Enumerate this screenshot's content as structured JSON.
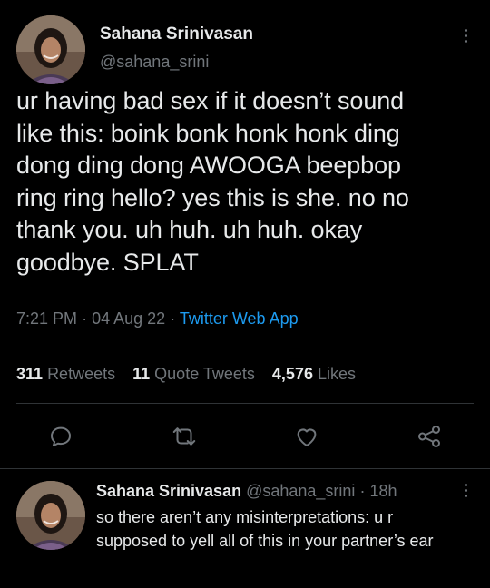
{
  "tweet": {
    "author_name": "Sahana Srinivasan",
    "author_handle": "@sahana_srini",
    "text": "ur having bad sex if it doesn’t sound\nlike this: boink bonk honk honk ding\ndong ding dong AWOOGA beepbop\nring ring hello? yes this is she. no no\nthank you. uh huh. uh huh. okay\ngoodbye. SPLAT",
    "time": "7:21 PM",
    "date": "04 Aug 22",
    "separator": "·",
    "source": "Twitter Web App"
  },
  "stats": {
    "retweets_count": "311",
    "retweets_label": "Retweets",
    "quotes_count": "11",
    "quotes_label": "Quote Tweets",
    "likes_count": "4,576",
    "likes_label": "Likes"
  },
  "actions": [
    "reply-icon",
    "retweet-icon",
    "like-icon",
    "share-icon"
  ],
  "reply": {
    "author_name": "Sahana Srinivasan",
    "author_handle": "@sahana_srini",
    "separator": "·",
    "age": "18h",
    "text": "so there aren’t any misinterpretations: u r supposed to yell all of this in your partner’s ear"
  },
  "colors": {
    "background": "#000000",
    "text": "#e7e9ea",
    "secondary": "#71767b",
    "link": "#1d9bf0",
    "divider": "#2f3336"
  }
}
